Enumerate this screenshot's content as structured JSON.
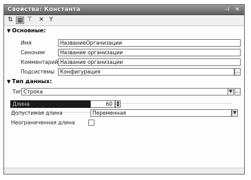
{
  "window": {
    "title": "Свойства: Константа",
    "pin": "⊣",
    "close": "✕"
  },
  "toolbar": {
    "sort_icon": "⇅",
    "categories_icon": "▦",
    "filter_icon": "⊤",
    "x_label": "✕",
    "y_label": "Y"
  },
  "sections": {
    "main": {
      "arrow": "▼",
      "title": "Основные:"
    },
    "datatype": {
      "arrow": "▼",
      "title": "Тип данных:"
    }
  },
  "fields": {
    "name": {
      "label": "Имя",
      "value": "НазваниеОрганизации"
    },
    "synonym": {
      "label": "Синоним",
      "value": "Название организации"
    },
    "comment": {
      "label": "Комментарий",
      "value": "Название организации"
    },
    "subsystems": {
      "label": "Подсистемы",
      "value": "Конфигурация",
      "button": "..."
    },
    "type": {
      "label": "Тип",
      "value": "Строка",
      "dropdown": "▼",
      "button": "..."
    },
    "length": {
      "label": "Длина",
      "value": "60",
      "up": "▲",
      "down": "▼"
    },
    "allowed_length": {
      "label": "Допустимая длина",
      "value": "Переменная",
      "dropdown": "▼"
    },
    "unlimited_length": {
      "label": "Неограниченная длина",
      "checked": false
    }
  }
}
